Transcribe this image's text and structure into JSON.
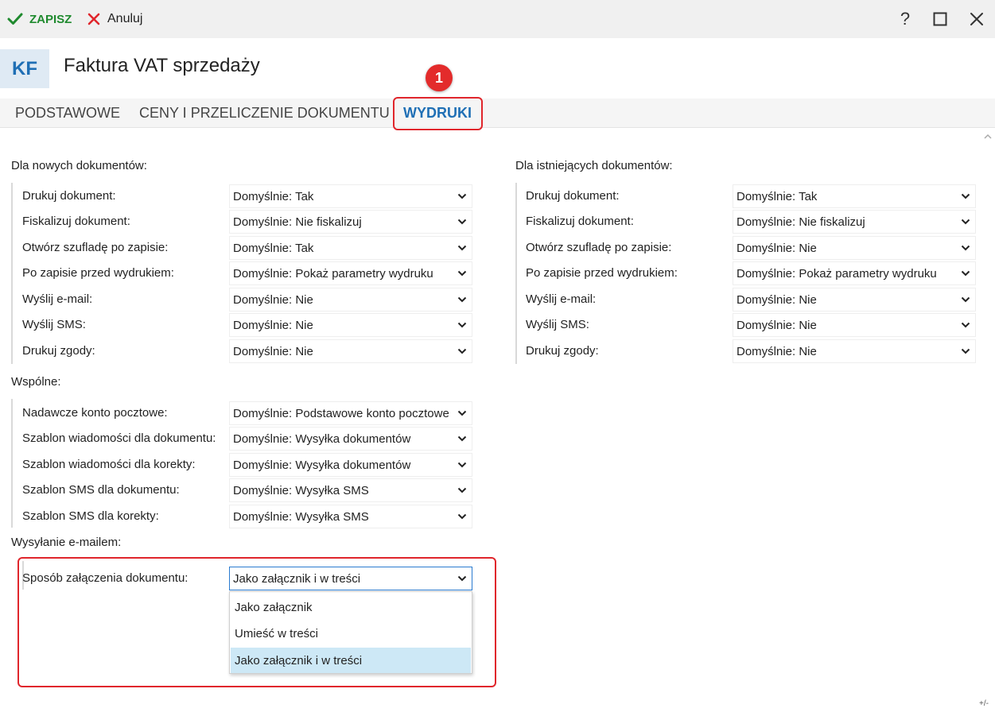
{
  "toolbar": {
    "save_label": "ZAPISZ",
    "cancel_label": "Anuluj",
    "help_symbol": "?"
  },
  "header": {
    "badge": "KF",
    "title": "Faktura VAT sprzedaży"
  },
  "tabs": [
    {
      "label": "PODSTAWOWE"
    },
    {
      "label": "CENY I PRZELICZENIE DOKUMENTU"
    },
    {
      "label": "WYDRUKI",
      "active": true
    }
  ],
  "callout_number": "1",
  "new_docs": {
    "title": "Dla nowych dokumentów:",
    "rows": [
      {
        "label": "Drukuj dokument:",
        "value": "Domyślnie: Tak"
      },
      {
        "label": "Fiskalizuj dokument:",
        "value": "Domyślnie: Nie fiskalizuj"
      },
      {
        "label": "Otwórz szufladę po zapisie:",
        "value": "Domyślnie: Tak"
      },
      {
        "label": "Po zapisie przed wydrukiem:",
        "value": "Domyślnie: Pokaż parametry wydruku"
      },
      {
        "label": "Wyślij e-mail:",
        "value": "Domyślnie: Nie"
      },
      {
        "label": "Wyślij SMS:",
        "value": "Domyślnie: Nie"
      },
      {
        "label": "Drukuj zgody:",
        "value": "Domyślnie: Nie"
      }
    ]
  },
  "existing_docs": {
    "title": "Dla istniejących dokumentów:",
    "rows": [
      {
        "label": "Drukuj dokument:",
        "value": "Domyślnie: Tak"
      },
      {
        "label": "Fiskalizuj dokument:",
        "value": "Domyślnie: Nie fiskalizuj"
      },
      {
        "label": "Otwórz szufladę po zapisie:",
        "value": "Domyślnie: Nie"
      },
      {
        "label": "Po zapisie przed wydrukiem:",
        "value": "Domyślnie: Pokaż parametry wydruku"
      },
      {
        "label": "Wyślij e-mail:",
        "value": "Domyślnie: Nie"
      },
      {
        "label": "Wyślij SMS:",
        "value": "Domyślnie: Nie"
      },
      {
        "label": "Drukuj zgody:",
        "value": "Domyślnie: Nie"
      }
    ]
  },
  "common": {
    "title": "Wspólne:",
    "rows": [
      {
        "label": "Nadawcze konto pocztowe:",
        "value": "Domyślnie: Podstawowe konto pocztowe"
      },
      {
        "label": "Szablon wiadomości dla dokumentu:",
        "value": "Domyślnie: Wysyłka dokumentów"
      },
      {
        "label": "Szablon wiadomości dla korekty:",
        "value": "Domyślnie: Wysyłka dokumentów"
      },
      {
        "label": "Szablon SMS dla dokumentu:",
        "value": "Domyślnie: Wysyłka SMS"
      },
      {
        "label": "Szablon SMS dla korekty:",
        "value": "Domyślnie: Wysyłka SMS"
      }
    ]
  },
  "email": {
    "title": "Wysyłanie e-mailem:",
    "attach_label": "Sposób załączenia dokumentu:",
    "attach_value": "Jako załącznik i w treści",
    "options": [
      "Jako załącznik",
      "Umieść w treści",
      "Jako załącznik i w treści"
    ],
    "selected_index": 2
  },
  "footer": {
    "corner": "+/-"
  },
  "colors": {
    "accent": "#1f6fb5",
    "highlight": "#e0262c",
    "save_green": "#1f8a2e",
    "cancel_red": "#e0262c",
    "selected_option": "#cde8f6"
  }
}
